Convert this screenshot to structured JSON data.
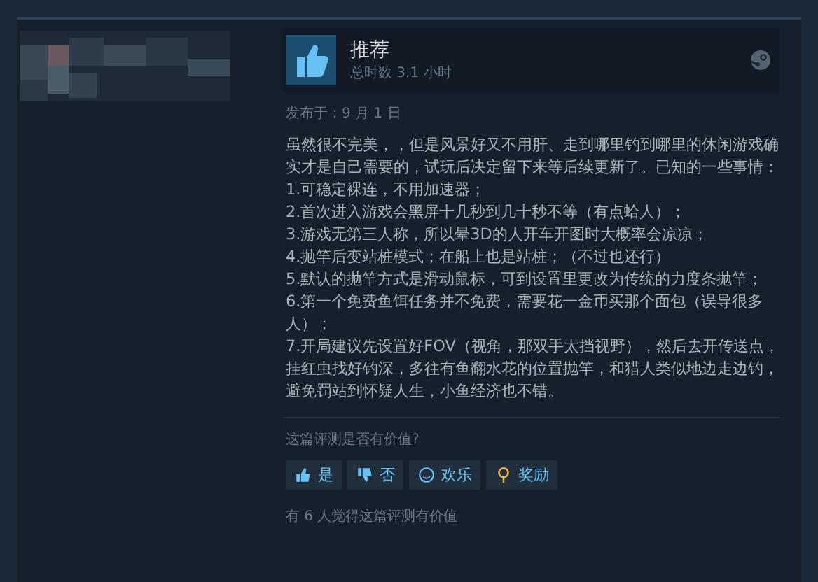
{
  "review": {
    "verdict": "推荐",
    "recommended": true,
    "hours": "总时数 3.1 小时",
    "posted": "发布于：9 月 1 日",
    "paragraphs": [
      "虽然很不完美，，但是风景好又不用肝、走到哪里钓到哪里的休闲游戏确实才是自己需要的，试玩后决定留下来等后续更新了。已知的一些事情：",
      "1.可稳定裸连，不用加速器；",
      "2.首次进入游戏会黑屏十几秒到几十秒不等（有点蛤人）；",
      "3.游戏无第三人称，所以晕3D的人开车开图时大概率会凉凉；",
      "4.抛竿后变站桩模式；在船上也是站桩；（不过也还行）",
      "5.默认的抛竿方式是滑动鼠标，可到设置里更改为传统的力度条抛竿；",
      "6.第一个免费鱼饵任务并不免费，需要花一金币买那个面包（误导很多人）；",
      "7.开局建议先设置好FOV（视角，那双手太挡视野），然后去开传送点，挂红虫找好钓深，多往有鱼翻水花的位置抛竿，和猎人类似地边走边钓，避免罚站到怀疑人生，小鱼经济也不错。"
    ]
  },
  "helpful": {
    "question": "这篇评测是否有价值?",
    "buttons": [
      {
        "kind": "yes",
        "label": "是"
      },
      {
        "kind": "no",
        "label": "否"
      },
      {
        "kind": "funny",
        "label": "欢乐"
      },
      {
        "kind": "award",
        "label": "奖励"
      }
    ],
    "summary": "有 6 人觉得这篇评测有价值"
  }
}
